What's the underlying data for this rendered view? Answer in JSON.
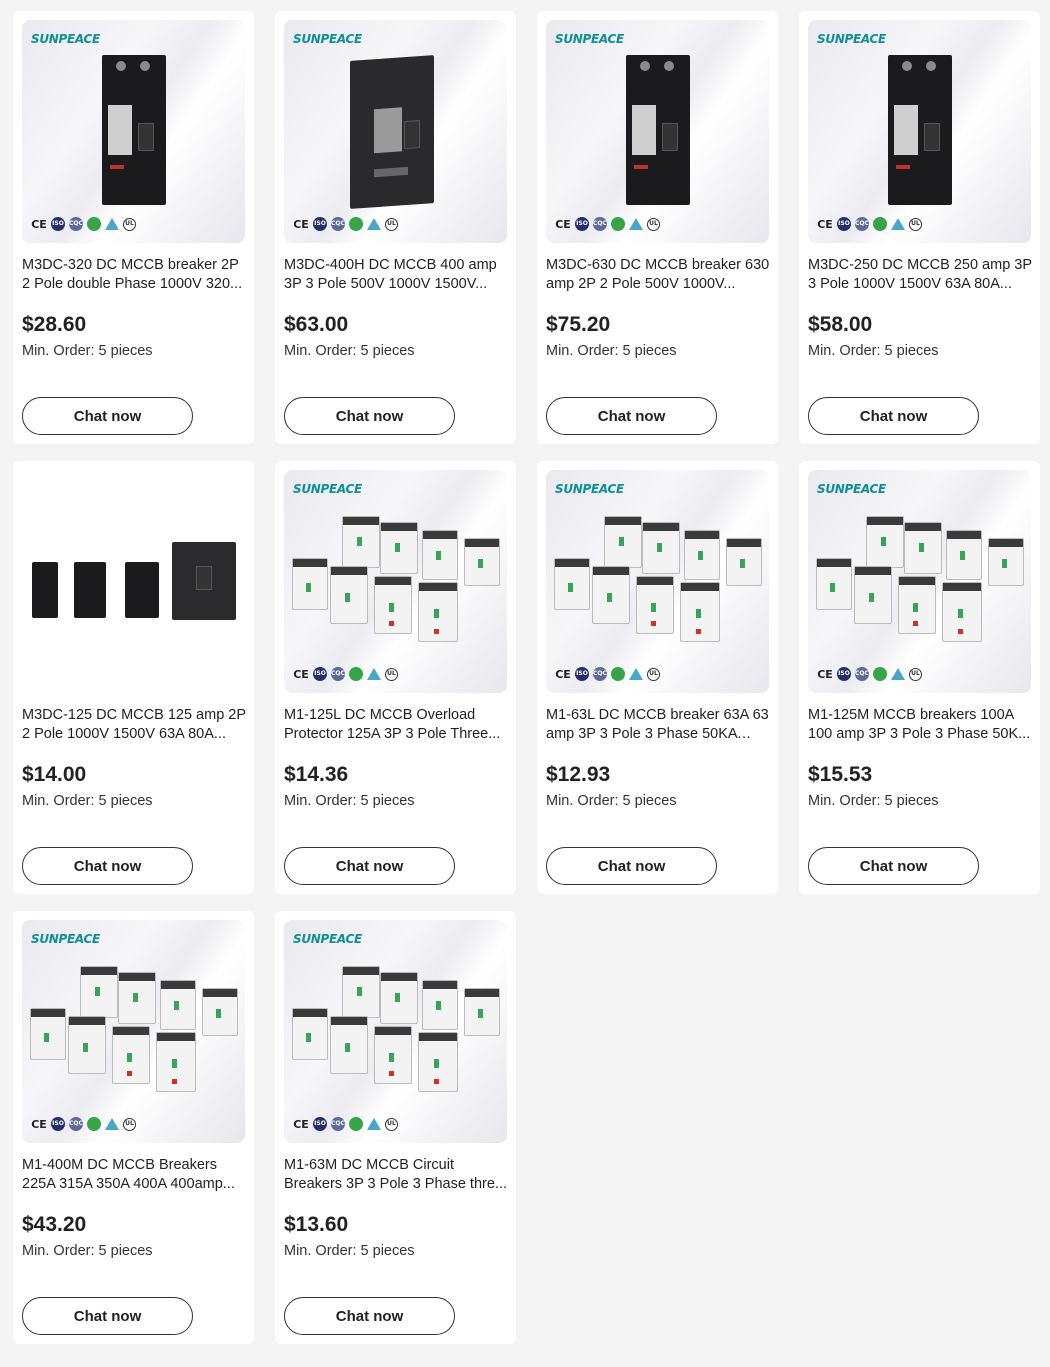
{
  "brand": "SUNPEACE",
  "certs": [
    "CE",
    "ISO",
    "CQC",
    "leaf",
    "triangle",
    "UL"
  ],
  "products": [
    {
      "title": "M3DC-320 DC MCCB breaker 2P 2 Pole double Phase 1000V 320...",
      "price": "$28.60",
      "moq": "Min. Order: 5 pieces",
      "cta": "Chat now"
    },
    {
      "title": "M3DC-400H DC MCCB 400 amp 3P 3 Pole 500V 1000V 1500V...",
      "price": "$63.00",
      "moq": "Min. Order: 5 pieces",
      "cta": "Chat now"
    },
    {
      "title": "M3DC-630 DC MCCB breaker 630 amp 2P 2 Pole 500V 1000V...",
      "price": "$75.20",
      "moq": "Min. Order: 5 pieces",
      "cta": "Chat now"
    },
    {
      "title": "M3DC-250 DC MCCB 250 amp 3P 3 Pole 1000V 1500V 63A 80A...",
      "price": "$58.00",
      "moq": "Min. Order: 5 pieces",
      "cta": "Chat now"
    },
    {
      "title": "M3DC-125 DC MCCB 125 amp 2P 2 Pole 1000V 1500V 63A 80A...",
      "price": "$14.00",
      "moq": "Min. Order: 5 pieces",
      "cta": "Chat now"
    },
    {
      "title": "M1-125L DC MCCB Overload Protector 125A 3P 3 Pole Three...",
      "price": "$14.36",
      "moq": "Min. Order: 5 pieces",
      "cta": "Chat now"
    },
    {
      "title": "M1-63L DC MCCB breaker 63A 63 amp 3P 3 Pole 3 Phase 50KA 6A...",
      "price": "$12.93",
      "moq": "Min. Order: 5 pieces",
      "cta": "Chat now"
    },
    {
      "title": "M1-125M MCCB breakers 100A 100 amp 3P 3 Pole 3 Phase 50K...",
      "price": "$15.53",
      "moq": "Min. Order: 5 pieces",
      "cta": "Chat now"
    },
    {
      "title": "M1-400M DC MCCB Breakers 225A 315A 350A 400A 400amp...",
      "price": "$43.20",
      "moq": "Min. Order: 5 pieces",
      "cta": "Chat now"
    },
    {
      "title": "M1-63M DC MCCB Circuit Breakers 3P 3 Pole 3 Phase thre...",
      "price": "$13.60",
      "moq": "Min. Order: 5 pieces",
      "cta": "Chat now"
    }
  ]
}
